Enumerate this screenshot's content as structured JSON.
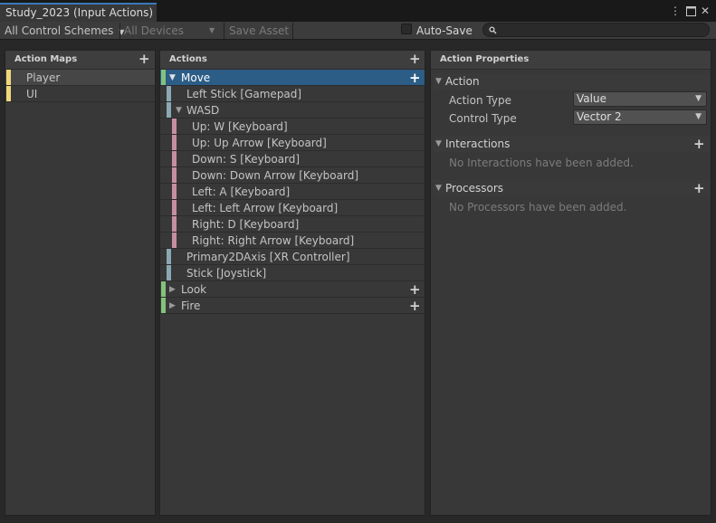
{
  "window": {
    "tab_title": "Study_2023 (Input Actions)",
    "menu_icon": "kebab-menu-icon",
    "maximize_icon": "maximize-icon",
    "close_icon": "close-icon"
  },
  "toolbar": {
    "control_scheme": "All Control Schemes",
    "devices": "All Devices",
    "save_asset": "Save Asset",
    "auto_save_label": "Auto-Save",
    "auto_save_checked": false,
    "search_placeholder": ""
  },
  "action_maps": {
    "header": "Action Maps",
    "items": [
      {
        "label": "Player",
        "selected": true
      },
      {
        "label": "UI",
        "selected": false
      }
    ]
  },
  "actions": {
    "header": "Actions",
    "rows": [
      {
        "label": "Move",
        "kind": "action",
        "expanded": true,
        "selected": true
      },
      {
        "label": "Left Stick [Gamepad]",
        "kind": "binding"
      },
      {
        "label": "WASD",
        "kind": "composite",
        "expanded": true
      },
      {
        "label": "Up: W [Keyboard]",
        "kind": "part"
      },
      {
        "label": "Up: Up Arrow [Keyboard]",
        "kind": "part"
      },
      {
        "label": "Down: S [Keyboard]",
        "kind": "part"
      },
      {
        "label": "Down: Down Arrow [Keyboard]",
        "kind": "part"
      },
      {
        "label": "Left: A [Keyboard]",
        "kind": "part"
      },
      {
        "label": "Left: Left Arrow [Keyboard]",
        "kind": "part"
      },
      {
        "label": "Right: D [Keyboard]",
        "kind": "part"
      },
      {
        "label": "Right: Right Arrow [Keyboard]",
        "kind": "part"
      },
      {
        "label": "Primary2DAxis [XR Controller]",
        "kind": "binding"
      },
      {
        "label": "Stick [Joystick]",
        "kind": "binding"
      },
      {
        "label": "Look",
        "kind": "action",
        "expanded": false
      },
      {
        "label": "Fire",
        "kind": "action",
        "expanded": false
      }
    ]
  },
  "properties": {
    "header": "Action Properties",
    "action_section": "Action",
    "action_type_label": "Action Type",
    "action_type_value": "Value",
    "control_type_label": "Control Type",
    "control_type_value": "Vector 2",
    "interactions_section": "Interactions",
    "interactions_empty": "No Interactions have been added.",
    "processors_section": "Processors",
    "processors_empty": "No Processors have been added."
  },
  "colors": {
    "map_bar": "#f0d77a",
    "action_bar": "#83c27c",
    "binding_bar": "#8aa9b2",
    "part_bar": "#c68ea3",
    "selection": "#2c5d87"
  }
}
